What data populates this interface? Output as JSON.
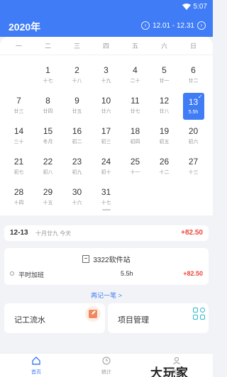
{
  "status": {
    "time": "5:07"
  },
  "header": {
    "year": "2020年",
    "range": "12.01 - 12.31",
    "prev_icon": "chevron-left-icon",
    "next_icon": "chevron-right-icon"
  },
  "calendar": {
    "weekdays": [
      "一",
      "二",
      "三",
      "四",
      "五",
      "六",
      "日"
    ],
    "weeks": [
      [
        {
          "d": "",
          "l": ""
        },
        {
          "d": "1",
          "l": "十七"
        },
        {
          "d": "2",
          "l": "十八"
        },
        {
          "d": "3",
          "l": "十九"
        },
        {
          "d": "4",
          "l": "二十"
        },
        {
          "d": "5",
          "l": "廿一"
        },
        {
          "d": "6",
          "l": "廿二"
        }
      ],
      [
        {
          "d": "7",
          "l": "廿三"
        },
        {
          "d": "8",
          "l": "廿四"
        },
        {
          "d": "9",
          "l": "廿五"
        },
        {
          "d": "10",
          "l": "廿六"
        },
        {
          "d": "11",
          "l": "廿七"
        },
        {
          "d": "12",
          "l": "廿八"
        },
        {
          "d": "13",
          "l": "",
          "hours": "5.5h",
          "selected": true
        }
      ],
      [
        {
          "d": "14",
          "l": "三十"
        },
        {
          "d": "15",
          "l": "冬月"
        },
        {
          "d": "16",
          "l": "初二"
        },
        {
          "d": "17",
          "l": "初三"
        },
        {
          "d": "18",
          "l": "初四"
        },
        {
          "d": "19",
          "l": "初五"
        },
        {
          "d": "20",
          "l": "初六"
        }
      ],
      [
        {
          "d": "21",
          "l": "初七"
        },
        {
          "d": "22",
          "l": "初八"
        },
        {
          "d": "23",
          "l": "初九"
        },
        {
          "d": "24",
          "l": "初十"
        },
        {
          "d": "25",
          "l": "十一"
        },
        {
          "d": "26",
          "l": "十二"
        },
        {
          "d": "27",
          "l": "十三"
        }
      ],
      [
        {
          "d": "28",
          "l": "十四"
        },
        {
          "d": "29",
          "l": "十五"
        },
        {
          "d": "30",
          "l": "十六"
        },
        {
          "d": "31",
          "l": "十七"
        },
        {
          "d": "",
          "l": ""
        },
        {
          "d": "",
          "l": ""
        },
        {
          "d": "",
          "l": ""
        }
      ]
    ]
  },
  "summary": {
    "date": "12-13",
    "lunar": "十月廿九 今天",
    "amount": "+82.50"
  },
  "record": {
    "title": "3322软件站",
    "entry": {
      "type": "平时加班",
      "hours": "5.5h",
      "amount": "+82.50"
    }
  },
  "add_more": "再记一笔 >",
  "cards": {
    "ledger": "记工流水",
    "projects": "项目管理"
  },
  "tabs": {
    "home": "首页",
    "stats": "统计",
    "mine": "我的"
  },
  "watermark": "大玩家",
  "colors": {
    "primary": "#3f7cf6",
    "income": "#f0443a"
  }
}
